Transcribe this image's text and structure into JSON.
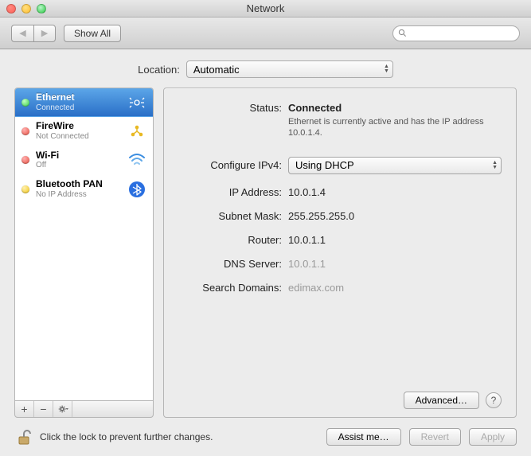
{
  "window": {
    "title": "Network"
  },
  "toolbar": {
    "show_all": "Show All",
    "search_placeholder": ""
  },
  "location": {
    "label": "Location:",
    "value": "Automatic"
  },
  "services": [
    {
      "name": "Ethernet",
      "sub": "Connected",
      "status": "green",
      "selected": true,
      "icon": "ethernet"
    },
    {
      "name": "FireWire",
      "sub": "Not Connected",
      "status": "red",
      "selected": false,
      "icon": "firewire"
    },
    {
      "name": "Wi-Fi",
      "sub": "Off",
      "status": "red",
      "selected": false,
      "icon": "wifi"
    },
    {
      "name": "Bluetooth PAN",
      "sub": "No IP Address",
      "status": "yellow",
      "selected": false,
      "icon": "bluetooth"
    }
  ],
  "details": {
    "status_label": "Status:",
    "status_value": "Connected",
    "status_desc": "Ethernet is currently active and has the IP address 10.0.1.4.",
    "configure_label": "Configure IPv4:",
    "configure_value": "Using DHCP",
    "ip_label": "IP Address:",
    "ip_value": "10.0.1.4",
    "subnet_label": "Subnet Mask:",
    "subnet_value": "255.255.255.0",
    "router_label": "Router:",
    "router_value": "10.0.1.1",
    "dns_label": "DNS Server:",
    "dns_value": "10.0.1.1",
    "search_label": "Search Domains:",
    "search_value": "edimax.com",
    "advanced": "Advanced…"
  },
  "footer": {
    "lock_text": "Click the lock to prevent further changes.",
    "assist": "Assist me…",
    "revert": "Revert",
    "apply": "Apply"
  }
}
